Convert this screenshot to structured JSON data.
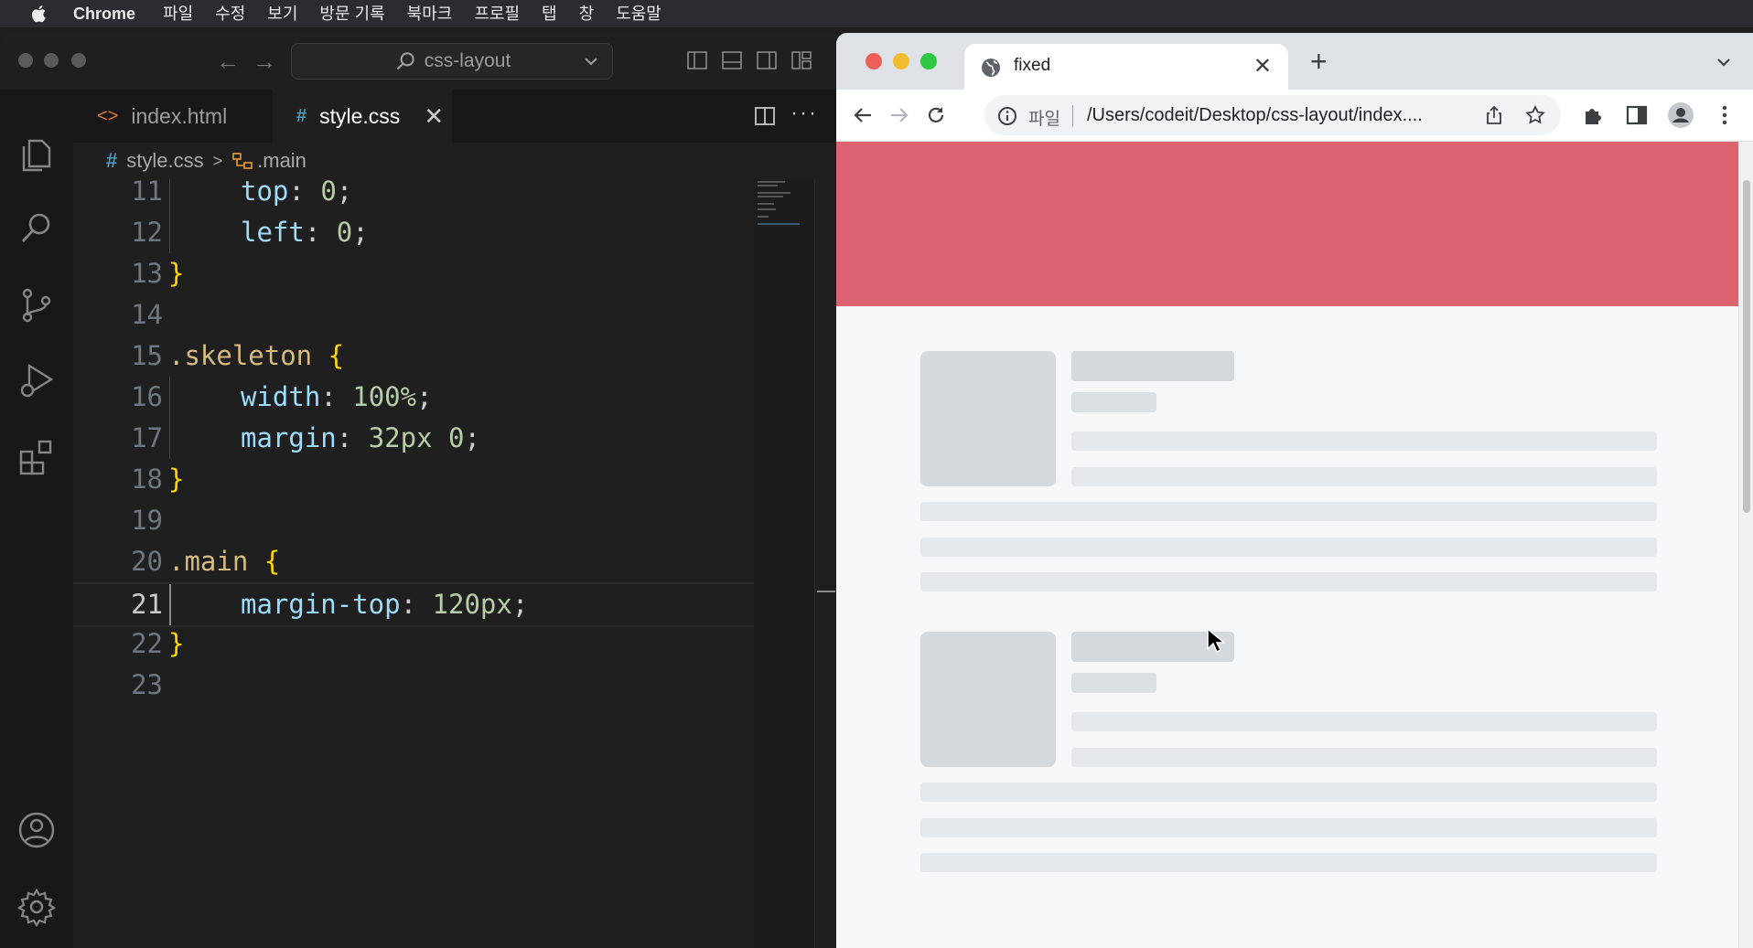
{
  "menubar": {
    "app": "Chrome",
    "items": [
      "파일",
      "수정",
      "보기",
      "방문 기록",
      "북마크",
      "프로필",
      "탭",
      "창",
      "도움말"
    ]
  },
  "vscode": {
    "command_center": "css-layout",
    "tabs": [
      {
        "icon": "<>",
        "label": "index.html",
        "active": false
      },
      {
        "icon": "#",
        "label": "style.css",
        "active": true
      }
    ],
    "breadcrumb": {
      "file": "style.css",
      "symbol": ".main"
    },
    "code": [
      {
        "line": "11",
        "indent": true,
        "parts": [
          [
            "prop",
            "top"
          ],
          [
            "punct",
            ": "
          ],
          [
            "num",
            "0"
          ],
          [
            "punct",
            ";"
          ]
        ]
      },
      {
        "line": "12",
        "indent": true,
        "parts": [
          [
            "prop",
            "left"
          ],
          [
            "punct",
            ": "
          ],
          [
            "num",
            "0"
          ],
          [
            "punct",
            ";"
          ]
        ]
      },
      {
        "line": "13",
        "indent": false,
        "parts": [
          [
            "brace",
            "}"
          ]
        ]
      },
      {
        "line": "14",
        "indent": false,
        "parts": []
      },
      {
        "line": "15",
        "indent": false,
        "parts": [
          [
            "sel",
            ".skeleton"
          ],
          [
            "punct",
            " "
          ],
          [
            "brace",
            "{"
          ]
        ]
      },
      {
        "line": "16",
        "indent": true,
        "parts": [
          [
            "prop",
            "width"
          ],
          [
            "punct",
            ": "
          ],
          [
            "num",
            "100%"
          ],
          [
            "punct",
            ";"
          ]
        ]
      },
      {
        "line": "17",
        "indent": true,
        "parts": [
          [
            "prop",
            "margin"
          ],
          [
            "punct",
            ": "
          ],
          [
            "num",
            "32px"
          ],
          [
            "punct",
            " "
          ],
          [
            "num",
            "0"
          ],
          [
            "punct",
            ";"
          ]
        ]
      },
      {
        "line": "18",
        "indent": false,
        "parts": [
          [
            "brace",
            "}"
          ]
        ]
      },
      {
        "line": "19",
        "indent": false,
        "parts": []
      },
      {
        "line": "20",
        "indent": false,
        "parts": [
          [
            "sel",
            ".main"
          ],
          [
            "punct",
            " "
          ],
          [
            "brace",
            "{"
          ]
        ]
      },
      {
        "line": "21",
        "indent": true,
        "current": true,
        "parts": [
          [
            "prop",
            "margin-top"
          ],
          [
            "punct",
            ": "
          ],
          [
            "num",
            "120px"
          ],
          [
            "punct",
            ";"
          ]
        ]
      },
      {
        "line": "22",
        "indent": false,
        "parts": [
          [
            "brace",
            "}"
          ]
        ]
      },
      {
        "line": "23",
        "indent": false,
        "parts": []
      }
    ]
  },
  "chrome": {
    "tab_title": "fixed",
    "scheme_label": "파일",
    "url": "/Users/codeit/Desktop/css-layout/index...."
  },
  "colors": {
    "header_block": "#de6372",
    "skeleton_image": "#d3d9dc",
    "skeleton_line": "#e4e8eb",
    "page_bg": "#f5f7f9"
  }
}
